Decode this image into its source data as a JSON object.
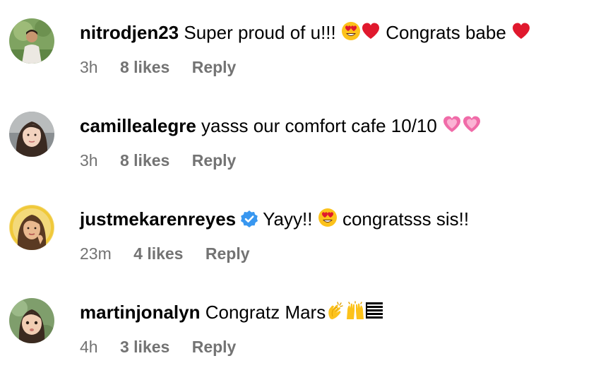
{
  "comments": [
    {
      "username": "nitrodjen23",
      "text_before": "Super proud of u!!!",
      "emojis_a": [
        "heart-eyes",
        "red-heart"
      ],
      "text_after": "Congrats babe",
      "emojis_b": [
        "red-heart"
      ],
      "time": "3h",
      "likes": "8 likes",
      "reply": "Reply"
    },
    {
      "username": "camillealegre",
      "text_before": "yasss our comfort cafe 10/10",
      "emojis_a": [
        "pink-heart",
        "pink-heart"
      ],
      "time": "3h",
      "likes": "8 likes",
      "reply": "Reply"
    },
    {
      "username": "justmekarenreyes",
      "verified": true,
      "text_before": "Yayy!!",
      "emojis_a": [
        "heart-eyes"
      ],
      "text_after": "congratsss sis!!",
      "time": "23m",
      "likes": "4 likes",
      "reply": "Reply"
    },
    {
      "username": "martinjonalyn",
      "text_before": "Congratz Mars",
      "emojis_a": [
        "clapping-hands",
        "raising-hands",
        "flag"
      ],
      "time": "4h",
      "likes": "3 likes",
      "reply": "Reply"
    }
  ],
  "colors": {
    "meta_text": "#737373",
    "verified_badge": "#3897f0",
    "red_heart": "#e0182d",
    "pink_heart": "#f06ba8"
  }
}
